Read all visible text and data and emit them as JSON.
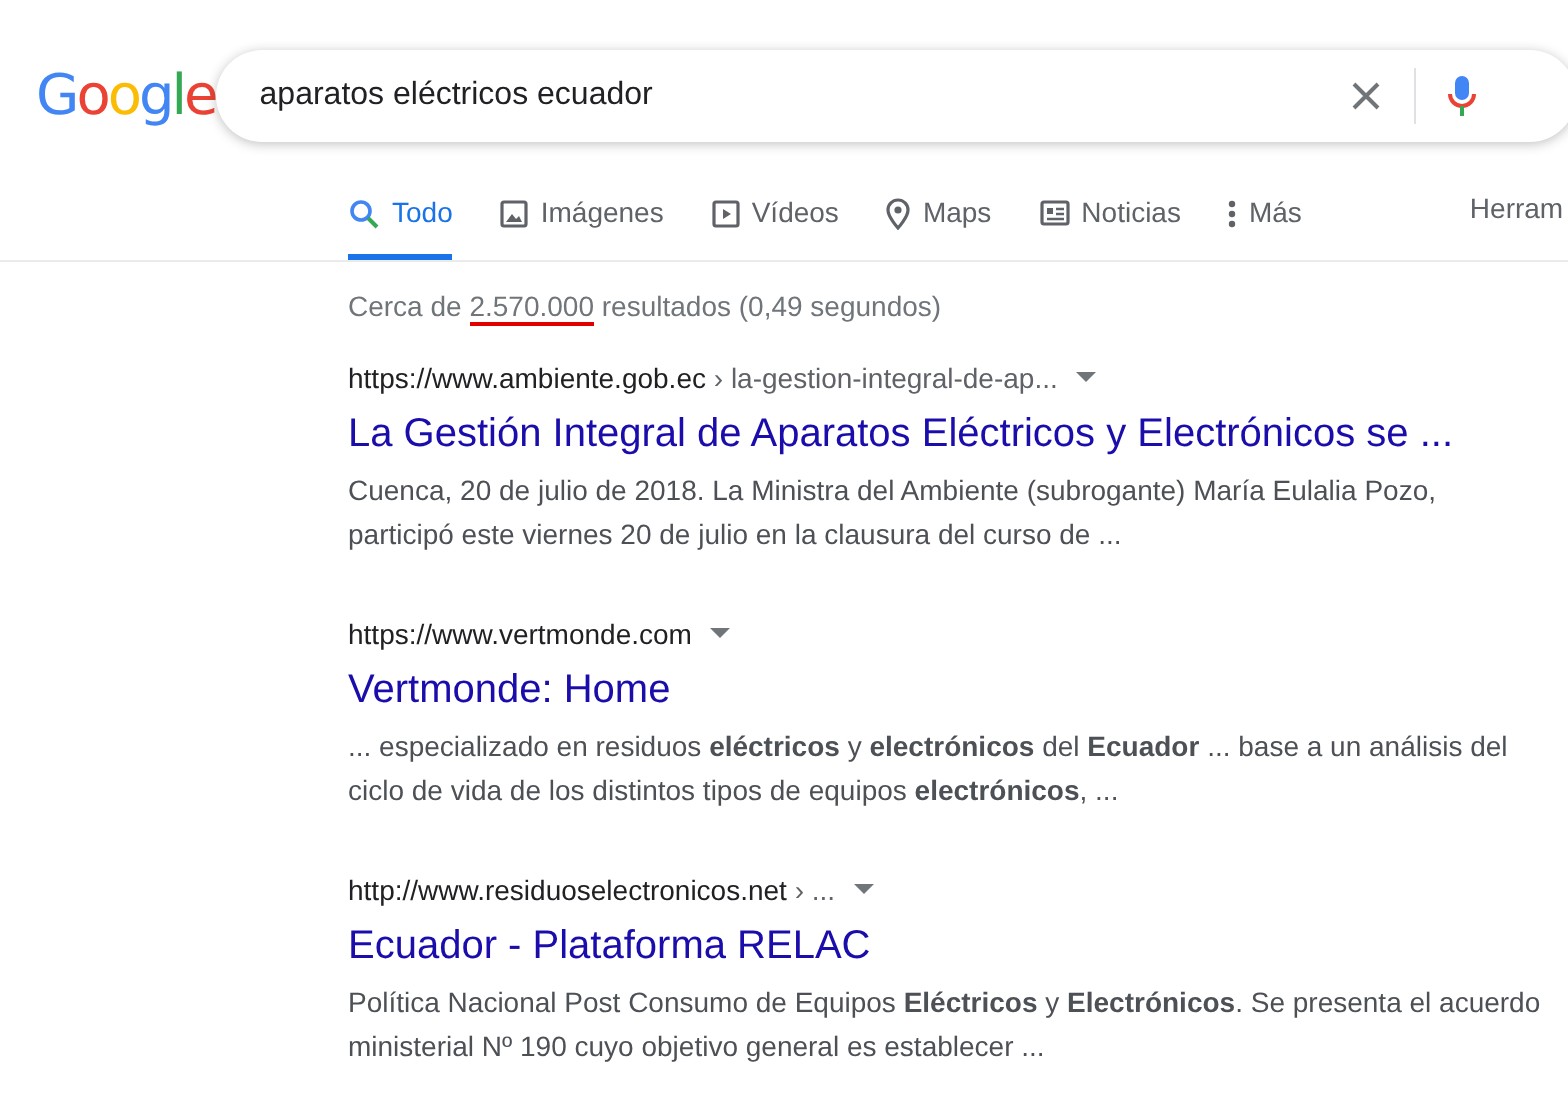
{
  "logo": "Google",
  "search": {
    "value": "aparatos eléctricos ecuador"
  },
  "tabs": [
    {
      "label": "Todo",
      "kind": "search",
      "selected": true
    },
    {
      "label": "Imágenes",
      "kind": "image",
      "selected": false
    },
    {
      "label": "Vídeos",
      "kind": "play",
      "selected": false
    },
    {
      "label": "Maps",
      "kind": "pin",
      "selected": false
    },
    {
      "label": "Noticias",
      "kind": "news",
      "selected": false
    },
    {
      "label": "Más",
      "kind": "dots",
      "selected": false
    }
  ],
  "tools": "Herram",
  "stats": {
    "prefix": "Cerca de ",
    "count": "2.570.000",
    "suffix": " resultados (0,49 segundos)",
    "count_underlined": true
  },
  "results": [
    {
      "url": "https://www.ambiente.gob.ec",
      "path": " › la-gestion-integral-de-ap...",
      "title": "La Gestión Integral de Aparatos Eléctricos y Electrónicos se ...",
      "snippet": "Cuenca, 20 de julio de 2018. La Ministra del Ambiente (subrogante) María Eulalia Pozo, participó este viernes 20 de julio en la clausura del curso de ..."
    },
    {
      "url": "https://www.vertmonde.com",
      "title": "Vertmonde: Home",
      "snippet": "... especializado en residuos **eléctricos** y **electrónicos** del **Ecuador** ... base a un análisis del ciclo de vida de los distintos tipos de equipos **electrónicos**, ..."
    },
    {
      "url": "http://www.residuoselectronicos.net",
      "path": " › ...",
      "title": "Ecuador - Plataforma RELAC",
      "snippet": "Política Nacional Post Consumo de Equipos **Eléctricos** y **Electrónicos**. Se presenta el acuerdo ministerial Nº 190 cuyo objetivo general es establecer ..."
    }
  ]
}
